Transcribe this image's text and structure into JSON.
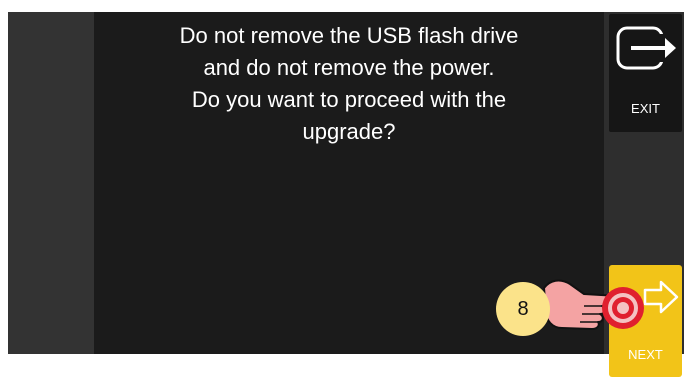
{
  "screen": {
    "message_lines": [
      "Do not remove the USB flash drive",
      "and do not remove the power.",
      "Do you want to proceed with the upgrade?"
    ]
  },
  "side_panel": {
    "exit_label": "EXIT",
    "exit_icon": "exit-arrow-icon",
    "next_label": "NEXT",
    "next_icon": "arrow-right-outline-icon"
  },
  "annotation": {
    "step_number": "8",
    "pointer_icon": "pointing-hand-icon"
  },
  "colors": {
    "screen_background": "#1b1b1b",
    "next_button": "#f2c418",
    "exit_button": "#161616",
    "step_badge": "#fbe38a",
    "target_ring": "#e0202e"
  }
}
